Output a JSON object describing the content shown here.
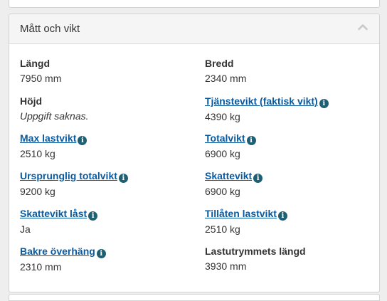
{
  "panel": {
    "title": "Mått och vikt"
  },
  "fields": [
    {
      "label": "Längd",
      "value": "7950 mm"
    },
    {
      "label": "Bredd",
      "value": "2340 mm"
    },
    {
      "label": "Höjd",
      "value": "Uppgift saknas."
    },
    {
      "label": "Tjänstevikt (faktisk vikt)",
      "value": "4390 kg"
    },
    {
      "label": "Max lastvikt",
      "value": "2510 kg"
    },
    {
      "label": "Totalvikt",
      "value": "6900 kg"
    },
    {
      "label": "Ursprunglig totalvikt",
      "value": "9200 kg"
    },
    {
      "label": "Skattevikt",
      "value": "6900 kg"
    },
    {
      "label": "Skattevikt låst",
      "value": "Ja"
    },
    {
      "label": "Tillåten lastvikt",
      "value": "2510 kg"
    },
    {
      "label": "Bakre överhäng",
      "value": "2310 mm"
    },
    {
      "label": "Lastutrymmets längd",
      "value": "3930 mm"
    }
  ],
  "icons": {
    "info": "info-icon",
    "collapse": "chevron-up-icon"
  },
  "colors": {
    "link": "#0a5aa0",
    "info_badge": "#1f5f73",
    "heading_bg": "#f5f5f5"
  }
}
